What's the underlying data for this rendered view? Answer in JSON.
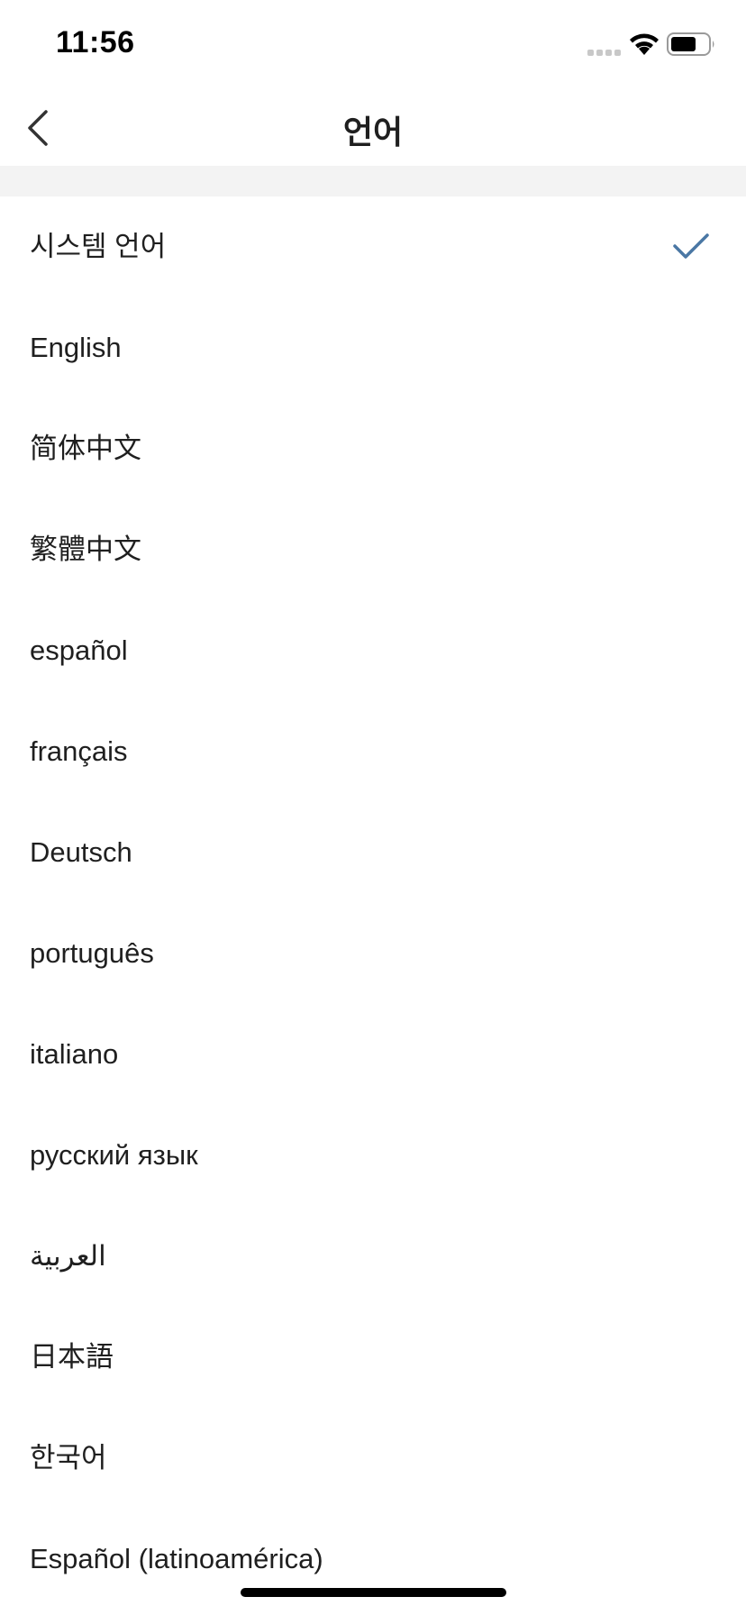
{
  "status_bar": {
    "time": "11:56"
  },
  "nav": {
    "title": "언어",
    "back_icon": "chevron-left-icon"
  },
  "languages": [
    {
      "label": "시스템 언어",
      "selected": true
    },
    {
      "label": "English",
      "selected": false
    },
    {
      "label": "简体中文",
      "selected": false
    },
    {
      "label": "繁體中文",
      "selected": false
    },
    {
      "label": "español",
      "selected": false
    },
    {
      "label": "français",
      "selected": false
    },
    {
      "label": "Deutsch",
      "selected": false
    },
    {
      "label": "português",
      "selected": false
    },
    {
      "label": "italiano",
      "selected": false
    },
    {
      "label": "русский язык",
      "selected": false
    },
    {
      "label": "العربية",
      "selected": false
    },
    {
      "label": "日本語",
      "selected": false
    },
    {
      "label": "한국어",
      "selected": false
    },
    {
      "label": "Español (latinoamérica)",
      "selected": false
    }
  ],
  "colors": {
    "check": "#4a77a4",
    "text": "#1f1f1f",
    "section_gap": "#f3f3f3"
  }
}
